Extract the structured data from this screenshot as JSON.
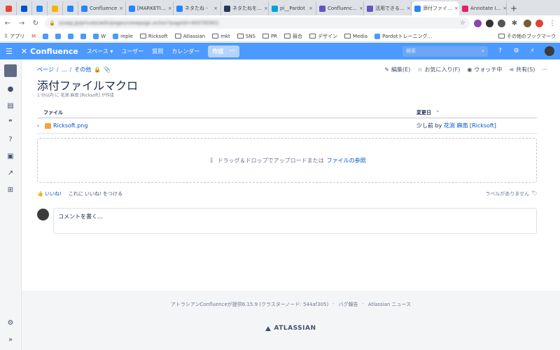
{
  "browser": {
    "tabs": [
      {
        "label": "",
        "favicon_color": "#ea4335",
        "kind": "pinned"
      },
      {
        "label": "",
        "favicon_color": "#0052cc",
        "kind": "pinned"
      },
      {
        "label": "",
        "favicon_color": "#2684ff",
        "kind": "pinned"
      },
      {
        "label": "",
        "favicon_color": "#f4b400",
        "kind": "pinned"
      },
      {
        "label": "",
        "favicon_color": "#2684ff",
        "kind": "pinned"
      },
      {
        "label": "Confluence",
        "favicon_color": "#2684ff"
      },
      {
        "label": "[MARKETI…",
        "favicon_color": "#2684ff"
      },
      {
        "label": "ネタたね -",
        "favicon_color": "#2684ff"
      },
      {
        "label": "ネタたねを…",
        "favicon_color": "#253858"
      },
      {
        "label": "pi__Pardot",
        "favicon_color": "#00a1e0"
      },
      {
        "label": "Confluenc…",
        "favicon_color": "#6554c0"
      },
      {
        "label": "活用できる…",
        "favicon_color": "#6554c0"
      },
      {
        "label": "添付ファイ…",
        "favicon_color": "#2684ff",
        "active": true
      },
      {
        "label": "Annotate I…",
        "favicon_color": "#e91e63"
      }
    ],
    "new_tab_label": "+",
    "url": "zzaqq.jp/private/wiki/pages/viewpage.action?pageId=400765901",
    "bookmarks": [
      {
        "label": "アプリ",
        "kind": "apps"
      },
      {
        "label": "",
        "kind": "gmail"
      },
      {
        "label": "",
        "kind": "icon"
      },
      {
        "label": "",
        "kind": "icon"
      },
      {
        "label": "",
        "kind": "icon"
      },
      {
        "label": "",
        "kind": "icon"
      },
      {
        "label": "W",
        "kind": "icon"
      },
      {
        "label": "reple",
        "kind": "link"
      },
      {
        "label": "Ricksoft",
        "kind": "folder"
      },
      {
        "label": "Atlassian",
        "kind": "folder"
      },
      {
        "label": "mkt",
        "kind": "folder"
      },
      {
        "label": "SNS",
        "kind": "folder"
      },
      {
        "label": "PR",
        "kind": "folder"
      },
      {
        "label": "競合",
        "kind": "folder"
      },
      {
        "label": "デザイン",
        "kind": "folder"
      },
      {
        "label": "Media",
        "kind": "folder"
      },
      {
        "label": "Pardotトレーニング…",
        "kind": "link"
      }
    ],
    "other_bookmarks": "その他のブックマーク"
  },
  "header": {
    "logo": "Confluence",
    "nav": [
      "スペース ▾",
      "ユーザー",
      "質問",
      "カレンダー"
    ],
    "create_label": "作成",
    "more_label": "···",
    "search_placeholder": "検索"
  },
  "breadcrumb": {
    "items": [
      "ページ",
      "…",
      "その他"
    ]
  },
  "page_actions": {
    "edit": "編集(E)",
    "favorite": "お気に入り(F)",
    "watch": "ウォッチ中",
    "share": "共有(S)",
    "more": "···"
  },
  "page": {
    "title": "添付ファイルマクロ",
    "byline": "1 分以内 に 花渕 麻南 [Ricksoft] が作成"
  },
  "attachments": {
    "col_file": "ファイル",
    "col_modified": "変更日",
    "sort_indicator": "⌃",
    "rows": [
      {
        "file": "Ricksoft.png",
        "modified_prefix": "少し前 by",
        "modified_user": "花渕 麻南 [Ricksoft]"
      }
    ],
    "drop_text": "ドラッグ＆ドロップでアップロードまたは",
    "browse_link": "ファイルの参照"
  },
  "likes": {
    "like_label": "いいね!",
    "prompt": "これに いいね! をつける"
  },
  "labels": {
    "empty_text": "ラベルがありません"
  },
  "comment": {
    "placeholder": "コメントを書く…"
  },
  "footer": {
    "powered": "アトラシアンConfluenceが提供6.15.9 (クラスターノード: 544af305)",
    "bug_report": "バグ報告",
    "news": "Atlassian ニュース",
    "logo": "ATLASSIAN"
  }
}
